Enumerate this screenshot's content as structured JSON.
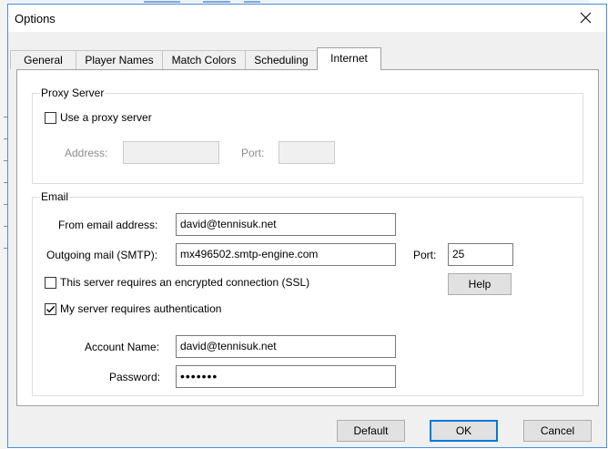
{
  "window": {
    "title": "Options",
    "close_glyph": "close-icon"
  },
  "tabs": [
    {
      "label": "General",
      "active": false
    },
    {
      "label": "Player Names",
      "active": false
    },
    {
      "label": "Match Colors",
      "active": false
    },
    {
      "label": "Scheduling",
      "active": false
    },
    {
      "label": "Internet",
      "active": true
    }
  ],
  "proxy": {
    "group_label": "Proxy Server",
    "use_proxy_label": "Use a proxy server",
    "use_proxy_checked": false,
    "address_label": "Address:",
    "address_value": "",
    "port_label": "Port:",
    "port_value": ""
  },
  "email": {
    "group_label": "Email",
    "from_label": "From email address:",
    "from_value": "david@tennisuk.net",
    "smtp_label": "Outgoing mail (SMTP):",
    "smtp_value": "mx496502.smtp-engine.com",
    "port_label": "Port:",
    "port_value": "25",
    "ssl_label": "This server requires an encrypted connection (SSL)",
    "ssl_checked": false,
    "help_label": "Help",
    "auth_label": "My server requires authentication",
    "auth_checked": true,
    "account_label": "Account Name:",
    "account_value": "david@tennisuk.net",
    "password_label": "Password:",
    "password_value": "•••••••"
  },
  "buttons": {
    "default_label": "Default",
    "ok_label": "OK",
    "cancel_label": "Cancel"
  },
  "colors": {
    "window_border": "#4a8fd8",
    "dialog_bg": "#f0f0f0",
    "focus_accent": "#0078d7"
  }
}
